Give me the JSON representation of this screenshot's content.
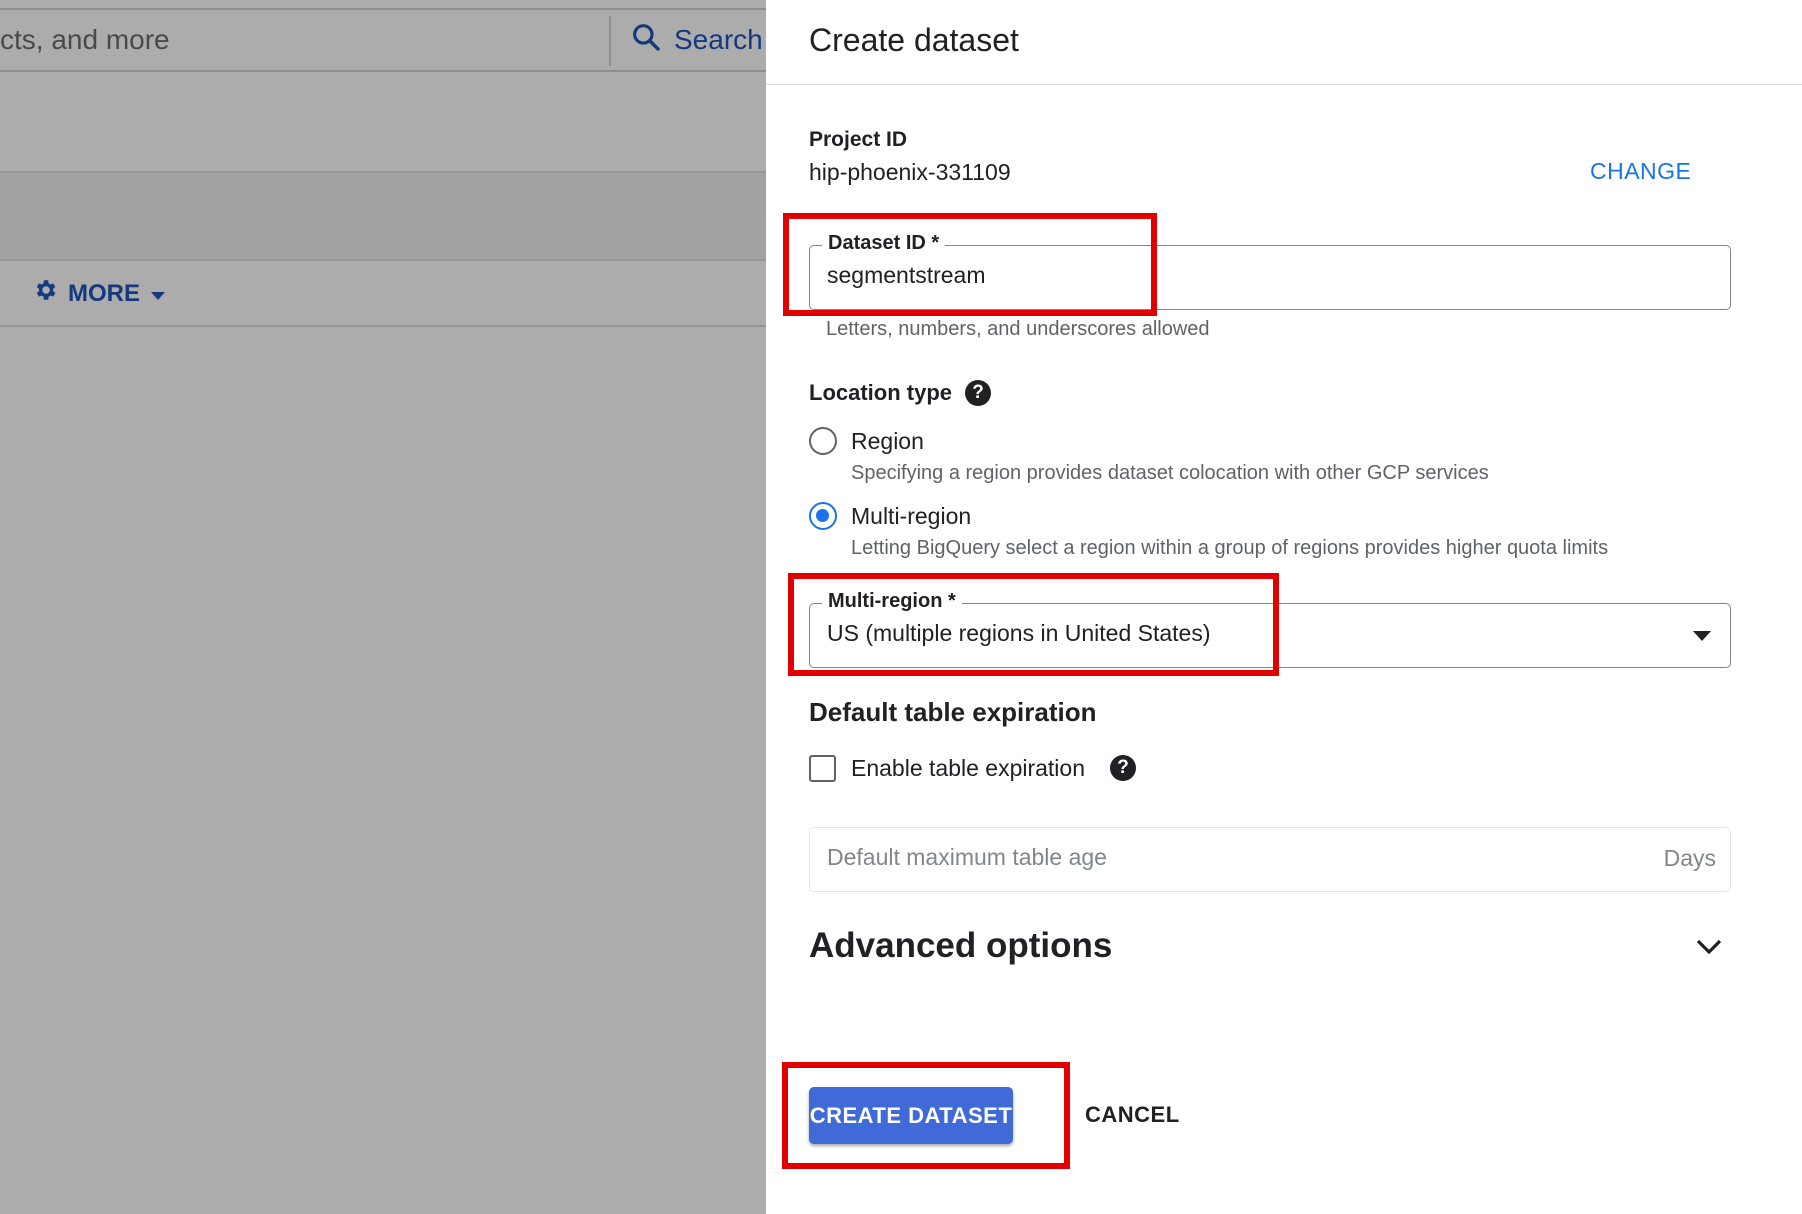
{
  "background": {
    "search_placeholder": "cts, and more",
    "search_button": "Search",
    "more_button": "MORE",
    "icons": {
      "search": "search-icon",
      "gear": "gear-icon",
      "dropdown": "caret-down-icon"
    }
  },
  "dialog": {
    "title": "Create dataset",
    "project": {
      "label": "Project ID",
      "value": "hip-phoenix-331109",
      "change_button": "CHANGE"
    },
    "dataset_id": {
      "label": "Dataset ID *",
      "value": "segmentstream",
      "hint": "Letters, numbers, and underscores allowed"
    },
    "location_type": {
      "label": "Location type",
      "options": [
        {
          "label": "Region",
          "description": "Specifying a region provides dataset colocation with other GCP services",
          "selected": false
        },
        {
          "label": "Multi-region",
          "description": "Letting BigQuery select a region within a group of regions provides higher quota limits",
          "selected": true
        }
      ]
    },
    "multi_region": {
      "label": "Multi-region *",
      "value": "US (multiple regions in United States)"
    },
    "table_expiration": {
      "heading": "Default table expiration",
      "checkbox_label": "Enable table expiration",
      "checked": false,
      "max_age_placeholder": "Default maximum table age",
      "max_age_suffix": "Days"
    },
    "advanced": {
      "label": "Advanced options"
    },
    "actions": {
      "create": "CREATE DATASET",
      "cancel": "CANCEL"
    }
  },
  "colors": {
    "accent": "#1a73e8",
    "primary_button": "#3f6ad8",
    "highlight_box": "#e00000",
    "overlay": "#acacac"
  }
}
